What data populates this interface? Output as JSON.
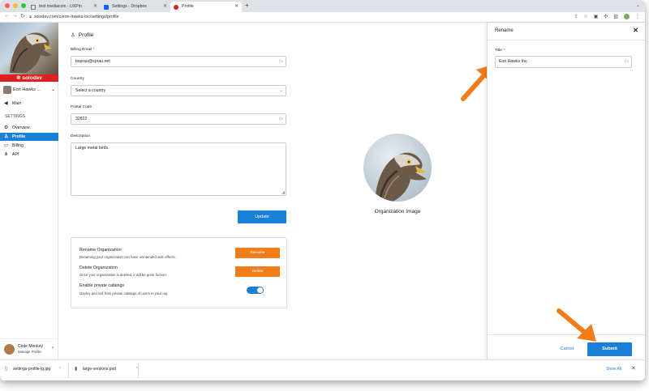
{
  "browser": {
    "tabs": [
      {
        "title": "test mediacoin - UXPin",
        "active": false
      },
      {
        "title": "Settings - Dropbox",
        "active": false
      },
      {
        "title": "Profile",
        "active": true
      }
    ],
    "url": "solodev.com/c/eon-hawks-inc/settings/profile"
  },
  "sidebar": {
    "brand": "solodev",
    "org_name": "Eon Hawks ...",
    "main_label": "Main",
    "section_label": "SETTINGS",
    "items": [
      {
        "label": "Overview",
        "active": false,
        "icon": "gear-icon"
      },
      {
        "label": "Profile",
        "active": true,
        "icon": "user-icon"
      },
      {
        "label": "Billing",
        "active": false,
        "icon": "card-icon"
      },
      {
        "label": "API",
        "active": false,
        "icon": "network-icon"
      }
    ],
    "user": {
      "name": "Code Monkey",
      "sub": "Manage Profile"
    }
  },
  "profile": {
    "title": "Profile",
    "billing_email_label": "Billing Email",
    "billing_email_value": "bsprau@sprau.net",
    "country_label": "Country",
    "country_value": "Select a country",
    "postal_label": "Postal Code",
    "postal_value": "32822",
    "description_label": "Description",
    "description_value": "Large metal birds.",
    "update_label": "Update",
    "org_image_label": "Organization Image"
  },
  "danger": {
    "rename_title": "Rename Organization",
    "rename_desc": "Renaming your organization can have unintended side effects.",
    "rename_btn": "Rename",
    "delete_title": "Delete Organization",
    "delete_desc": "Once your organization is deleted, it will be gone forever.",
    "delete_btn": "Delete",
    "private_title": "Enable private catalogs",
    "private_desc": "Deploy and sell from private catalogs of users in your org",
    "private_enabled": true
  },
  "rename_panel": {
    "title": "Rename",
    "field_label": "Title",
    "field_value": "Eon Hawks Inc",
    "cancel_label": "Cancel",
    "submit_label": "Submit"
  },
  "downloads": {
    "items": [
      "settings-profile-lg.jpg",
      "large-versions.psd"
    ],
    "show_all": "Show All"
  },
  "colors": {
    "accent": "#1a7fd6",
    "danger_btn": "#f07c1a",
    "brand_red": "#e02020",
    "annotation_arrow": "#f07c1a"
  }
}
